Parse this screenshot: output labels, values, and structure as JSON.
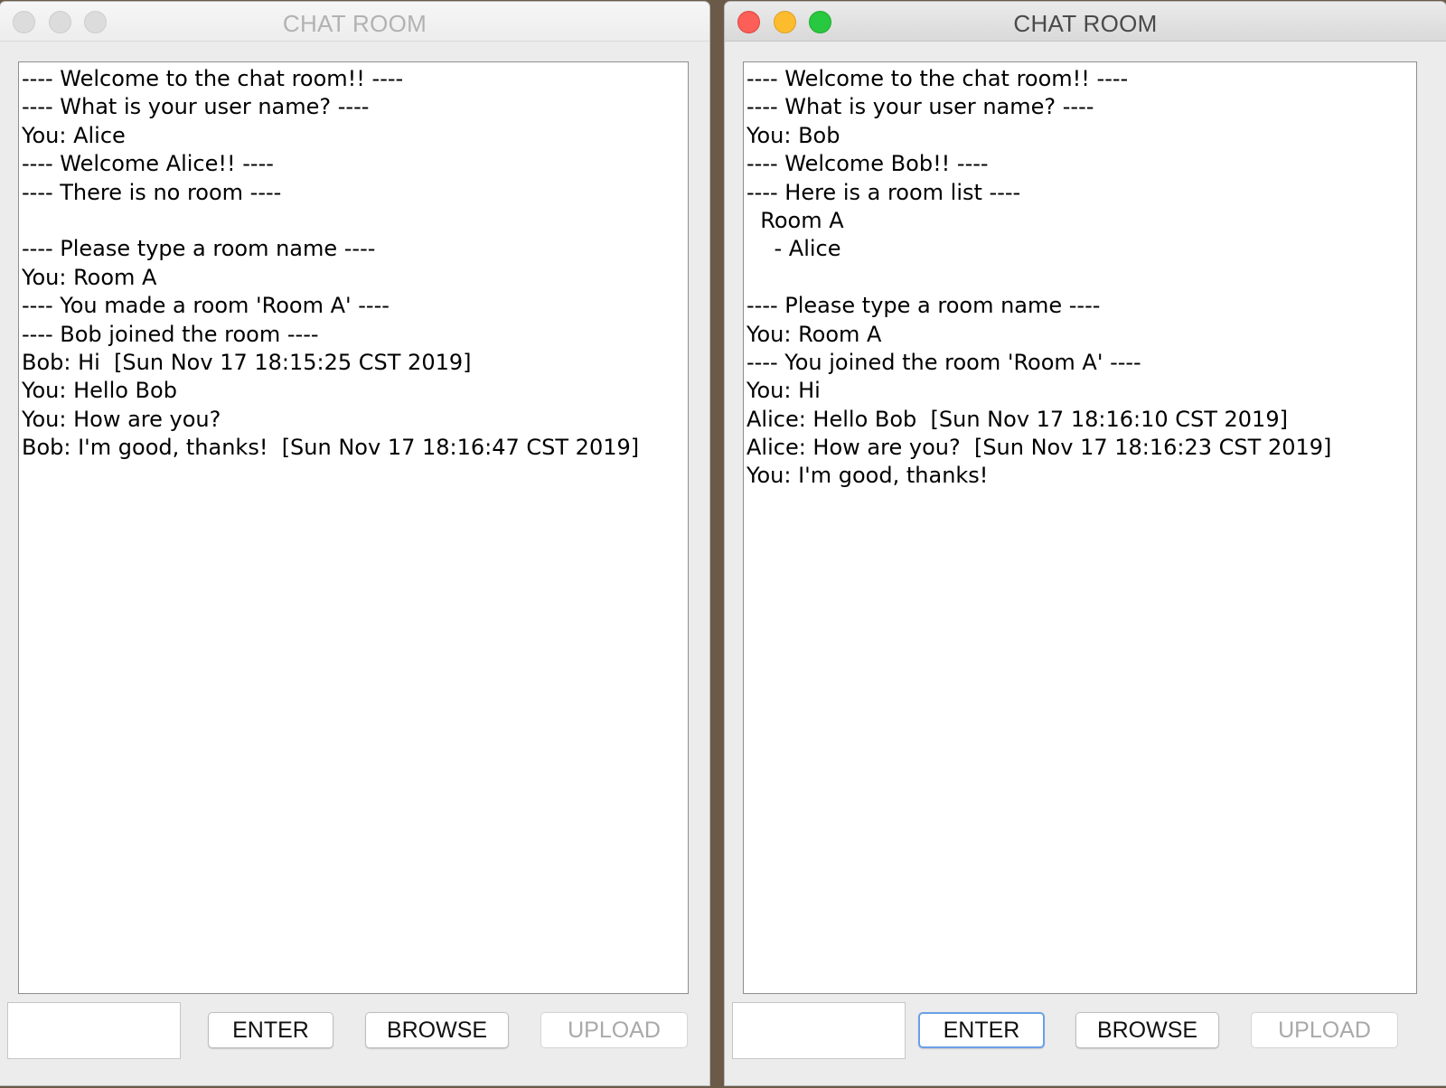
{
  "windows": [
    {
      "title": "CHAT ROOM",
      "active": false,
      "lines": [
        "---- Welcome to the chat room!! ----",
        "---- What is your user name? ----",
        "You: Alice",
        "---- Welcome Alice!! ----",
        "---- There is no room ----",
        "",
        "---- Please type a room name ----",
        "You: Room A",
        "---- You made a room 'Room A' ----",
        "---- Bob joined the room ----",
        "Bob: Hi  [Sun Nov 17 18:15:25 CST 2019]",
        "You: Hello Bob",
        "You: How are you?",
        "Bob: I'm good, thanks!  [Sun Nov 17 18:16:47 CST 2019]"
      ],
      "input_value": "",
      "buttons": {
        "enter": "ENTER",
        "browse": "BROWSE",
        "upload": "UPLOAD"
      }
    },
    {
      "title": "CHAT ROOM",
      "active": true,
      "lines": [
        "---- Welcome to the chat room!! ----",
        "---- What is your user name? ----",
        "You: Bob",
        "---- Welcome Bob!! ----",
        "---- Here is a room list ----",
        "  Room A",
        "    - Alice",
        "",
        "---- Please type a room name ----",
        "You: Room A",
        "---- You joined the room 'Room A' ----",
        "You: Hi",
        "Alice: Hello Bob  [Sun Nov 17 18:16:10 CST 2019]",
        "Alice: How are you?  [Sun Nov 17 18:16:23 CST 2019]",
        "You: I'm good, thanks!"
      ],
      "input_value": "",
      "buttons": {
        "enter": "ENTER",
        "browse": "BROWSE",
        "upload": "UPLOAD"
      }
    }
  ],
  "icons": {
    "close": "close-icon",
    "minimize": "minimize-icon",
    "zoom": "zoom-icon"
  },
  "colors": {
    "close_red": "#fc5f57",
    "minimize_yellow": "#fdbc2e",
    "zoom_green": "#28c840",
    "focus_ring": "#6aa0e6",
    "disabled_text": "#a9a9a9"
  }
}
